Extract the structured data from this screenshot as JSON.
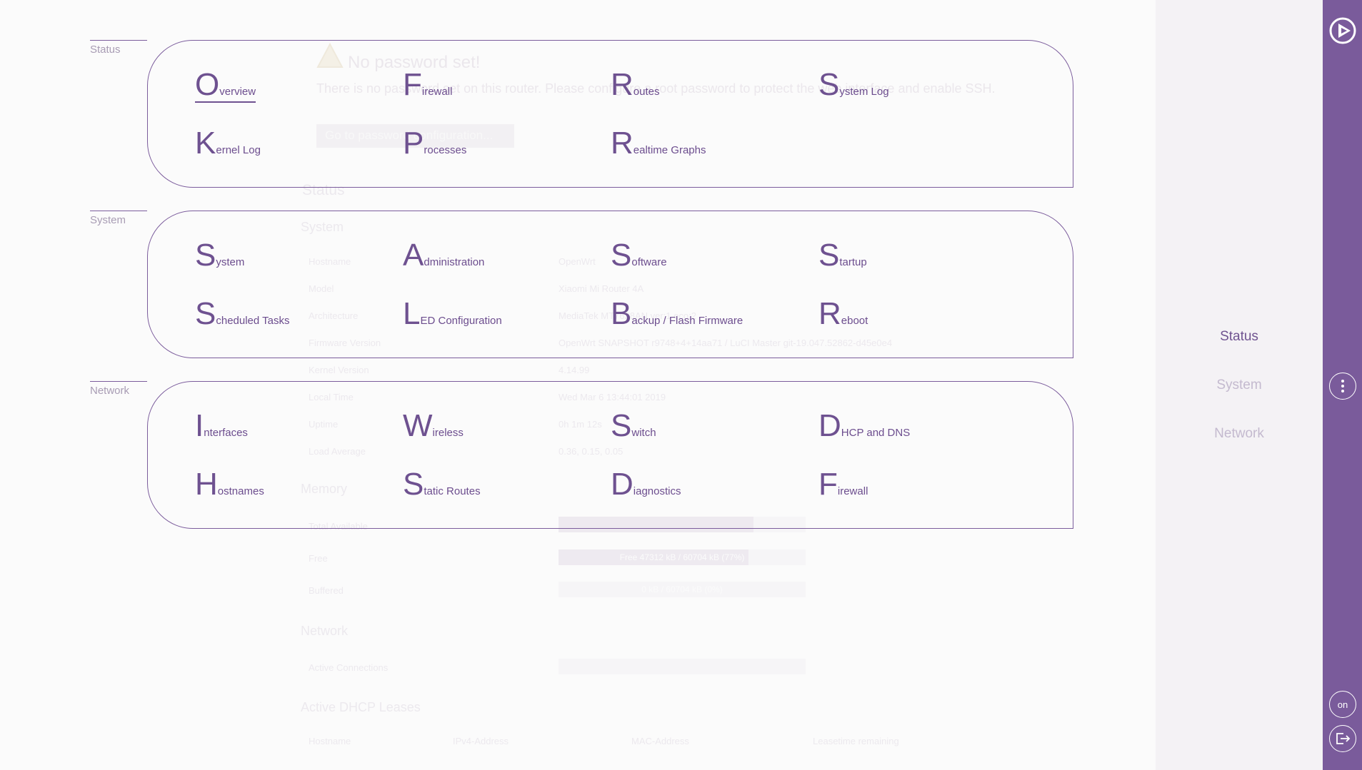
{
  "background": {
    "warning": {
      "title": "No password set!",
      "text": "There is no password set on this router. Please configure a root password to protect the web interface and enable SSH.",
      "button_label": "Go to password configuration..."
    },
    "status_title": "Status",
    "system_title": "System",
    "system_rows": [
      {
        "key": "Hostname",
        "value": "OpenWrt"
      },
      {
        "key": "Model",
        "value": "Xiaomi Mi Router 4A"
      },
      {
        "key": "Architecture",
        "value": "MediaTek MT7628AN ver:1 eco:2"
      },
      {
        "key": "Firmware Version",
        "value": "OpenWrt SNAPSHOT r9748+4+14aa71 / LuCI Master git-19.047.52862-d45e0e4"
      },
      {
        "key": "Kernel Version",
        "value": "4.14.99"
      },
      {
        "key": "Local Time",
        "value": "Wed Mar 6 13:44:01 2019"
      },
      {
        "key": "Uptime",
        "value": "0h 1m 12s"
      },
      {
        "key": "Load Average",
        "value": "0.36, 0.15, 0.05"
      }
    ],
    "memory_title": "Memory",
    "memory_rows": [
      {
        "key": "Total Available",
        "label": "",
        "fill": 0.79
      },
      {
        "key": "Free",
        "label": "Free 47312 kB / 60704 kB (77%)",
        "fill": 0.77
      },
      {
        "key": "Buffered",
        "label": "0 kB / 60704 kB (0%)",
        "fill": 0.0
      }
    ],
    "network_title": "Network",
    "network_rows": [
      {
        "key": "Active Connections",
        "label": ""
      }
    ],
    "dhcp_title": "Active DHCP Leases",
    "dhcp_headers": [
      "Hostname",
      "IPv4-Address",
      "MAC-Address",
      "Leasetime remaining"
    ]
  },
  "menu": {
    "sections": [
      {
        "label": "Status",
        "items": [
          {
            "first": "O",
            "rest": "verview",
            "active": true
          },
          {
            "first": "F",
            "rest": "irewall"
          },
          {
            "first": "R",
            "rest": "outes"
          },
          {
            "first": "S",
            "rest": "ystem Log"
          },
          {
            "first": "K",
            "rest": "ernel Log"
          },
          {
            "first": "P",
            "rest": "rocesses"
          },
          {
            "first": "R",
            "rest": "ealtime Graphs"
          }
        ]
      },
      {
        "label": "System",
        "items": [
          {
            "first": "S",
            "rest": "ystem"
          },
          {
            "first": "A",
            "rest": "dministration"
          },
          {
            "first": "S",
            "rest": "oftware"
          },
          {
            "first": "S",
            "rest": "tartup"
          },
          {
            "first": "S",
            "rest": "cheduled Tasks"
          },
          {
            "first": "L",
            "rest": "ED Configuration"
          },
          {
            "first": "B",
            "rest": "ackup / Flash Firmware"
          },
          {
            "first": "R",
            "rest": "eboot"
          }
        ]
      },
      {
        "label": "Network",
        "items": [
          {
            "first": "I",
            "rest": "nterfaces"
          },
          {
            "first": "W",
            "rest": "ireless"
          },
          {
            "first": "S",
            "rest": "witch"
          },
          {
            "first": "D",
            "rest": "HCP and DNS"
          },
          {
            "first": "H",
            "rest": "ostnames"
          },
          {
            "first": "S",
            "rest": "tatic Routes"
          },
          {
            "first": "D",
            "rest": "iagnostics"
          },
          {
            "first": "F",
            "rest": "irewall"
          }
        ]
      }
    ]
  },
  "context_menu": {
    "items": [
      {
        "label": "Status",
        "active": true
      },
      {
        "label": "System"
      },
      {
        "label": "Network"
      }
    ]
  },
  "sidebar": {
    "logo_icon": "openwrt-logo-icon",
    "more_icon": "vertical-dots-icon",
    "toggle_label": "on",
    "logout_icon": "logout-icon"
  },
  "colors": {
    "accent": "#7a5b9b",
    "menu_text": "#6c4d8e",
    "section_label": "#a89cb4",
    "context_inactive": "#c4bacf"
  }
}
